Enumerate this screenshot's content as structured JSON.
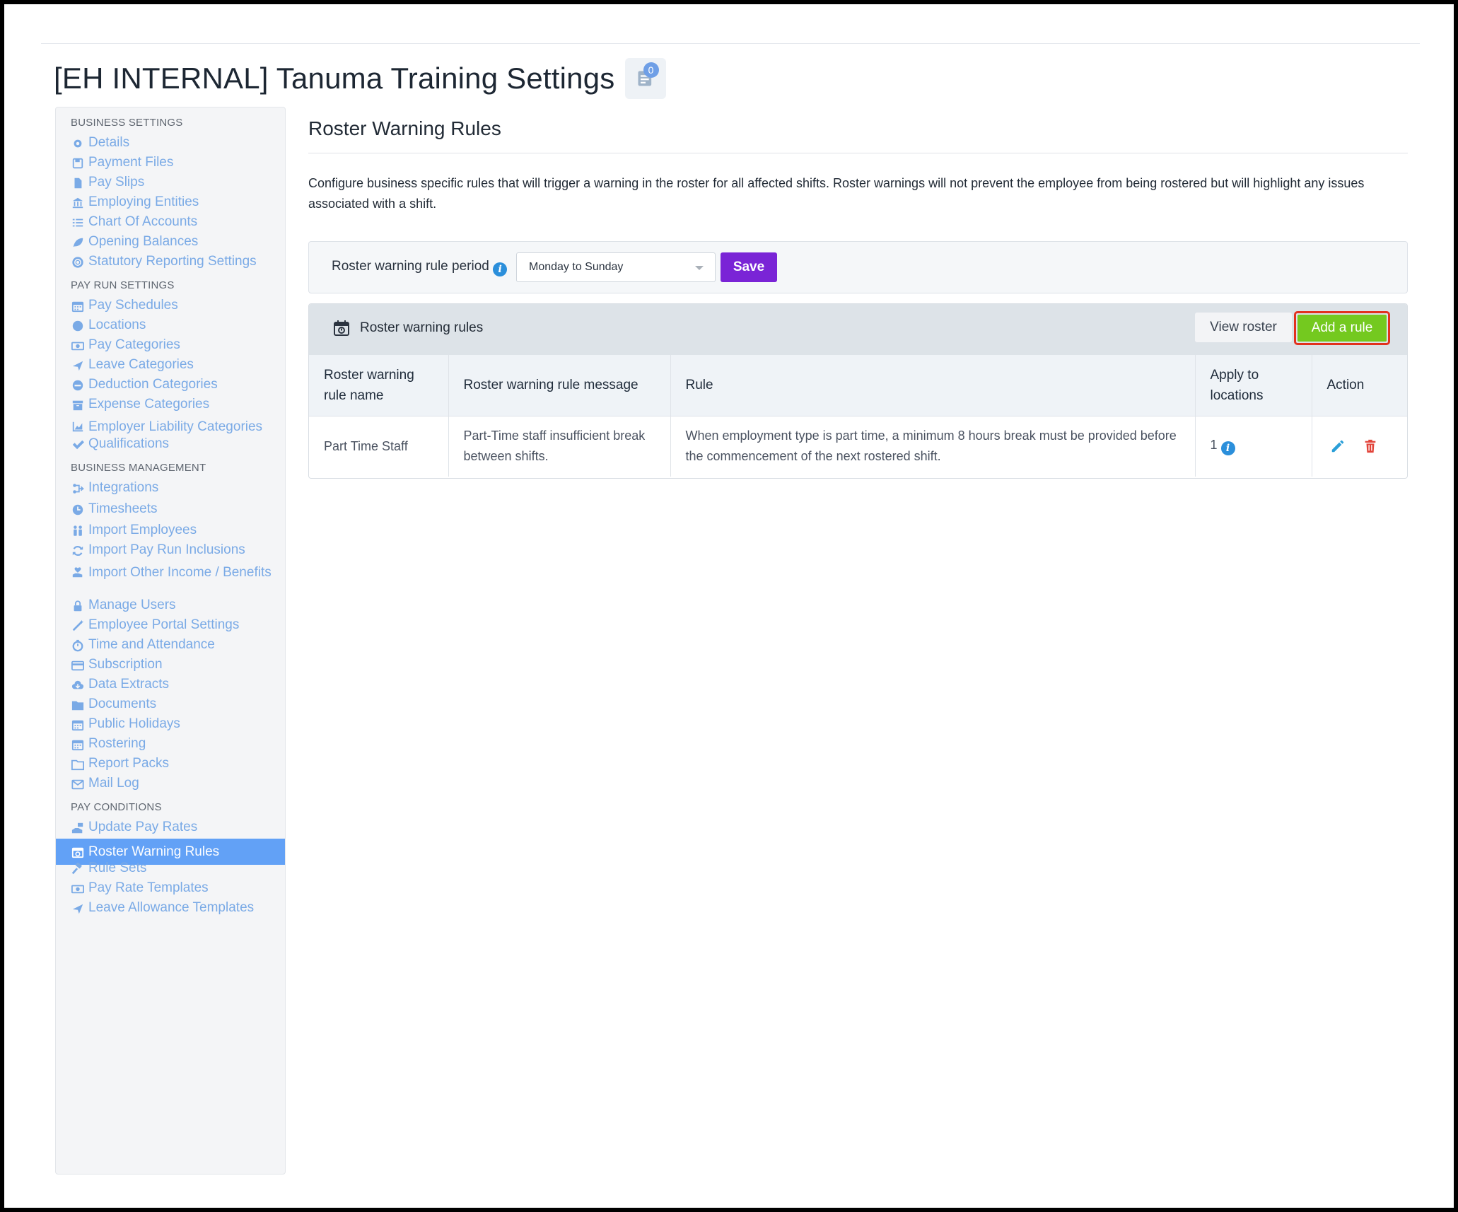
{
  "page": {
    "title": "[EH INTERNAL] Tanuma Training Settings",
    "notification_count": "0"
  },
  "sidebar": {
    "sections": [
      {
        "heading": "BUSINESS SETTINGS",
        "items": [
          {
            "label": "Details",
            "icon": "gear-icon"
          },
          {
            "label": "Payment Files",
            "icon": "floppy-icon"
          },
          {
            "label": "Pay Slips",
            "icon": "file-icon"
          },
          {
            "label": "Employing Entities",
            "icon": "bank-icon"
          },
          {
            "label": "Chart Of Accounts",
            "icon": "list-icon"
          },
          {
            "label": "Opening Balances",
            "icon": "leaf-icon"
          },
          {
            "label": "Statutory Reporting Settings",
            "icon": "lifebuoy-icon"
          }
        ]
      },
      {
        "heading": "PAY RUN SETTINGS",
        "items": [
          {
            "label": "Pay Schedules",
            "icon": "calendar-icon"
          },
          {
            "label": "Locations",
            "icon": "globe-icon"
          },
          {
            "label": "Pay Categories",
            "icon": "money-icon"
          },
          {
            "label": "Leave Categories",
            "icon": "plane-icon"
          },
          {
            "label": "Deduction Categories",
            "icon": "minus-circle-icon"
          },
          {
            "label": "Expense Categories",
            "icon": "archive-icon"
          },
          {
            "label": "Employer Liability Categories",
            "icon": "chart-icon"
          },
          {
            "label": "Qualifications",
            "icon": "check-icon"
          }
        ]
      },
      {
        "heading": "BUSINESS MANAGEMENT",
        "items": [
          {
            "label": "Integrations",
            "icon": "integrations-icon"
          },
          {
            "label": "Timesheets",
            "icon": "clock-icon"
          },
          {
            "label": "Import Employees",
            "icon": "people-icon"
          },
          {
            "label": "Import Pay Run Inclusions",
            "icon": "refresh-icon"
          },
          {
            "label": "Import Other Income / Benefits",
            "icon": "hand-heart-icon"
          },
          {
            "label": "Manage Users",
            "icon": "lock-icon"
          },
          {
            "label": "Employee Portal Settings",
            "icon": "wand-icon"
          },
          {
            "label": "Time and Attendance",
            "icon": "stopwatch-icon"
          },
          {
            "label": "Subscription",
            "icon": "credit-card-icon"
          },
          {
            "label": "Data Extracts",
            "icon": "cloud-download-icon"
          },
          {
            "label": "Documents",
            "icon": "folder-icon"
          },
          {
            "label": "Public Holidays",
            "icon": "calendar-icon"
          },
          {
            "label": "Rostering",
            "icon": "calendar-icon"
          },
          {
            "label": "Report Packs",
            "icon": "folder-open-icon"
          },
          {
            "label": "Mail Log",
            "icon": "envelope-icon"
          }
        ]
      },
      {
        "heading": "PAY CONDITIONS",
        "items": [
          {
            "label": "Update Pay Rates",
            "icon": "hand-money-icon"
          },
          {
            "label": "Roster Warning Rules",
            "icon": "calendar-alert-icon",
            "active": true
          },
          {
            "label": "Rule Sets",
            "icon": "gavel-icon"
          },
          {
            "label": "Pay Rate Templates",
            "icon": "money-icon"
          },
          {
            "label": "Leave Allowance Templates",
            "icon": "plane-icon"
          }
        ]
      }
    ]
  },
  "main": {
    "section_title": "Roster Warning Rules",
    "description": "Configure business specific rules that will trigger a warning in the roster for all affected shifts. Roster warnings will not prevent the employee from being rostered but will highlight any issues associated with a shift.",
    "period": {
      "label": "Roster warning rule period",
      "selected": "Monday to Sunday",
      "save_label": "Save"
    },
    "panel": {
      "title": "Roster warning rules",
      "view_roster_label": "View roster",
      "add_rule_label": "Add a rule",
      "columns": [
        "Roster warning rule name",
        "Roster warning rule message",
        "Rule",
        "Apply to locations",
        "Action"
      ],
      "rows": [
        {
          "name": "Part Time Staff",
          "message": "Part-Time staff insufficient break between shifts.",
          "rule": "When employment type is part time, a minimum 8 hours break must be provided before the commencement of the next rostered shift.",
          "locations": "1"
        }
      ]
    }
  },
  "colors": {
    "sidebar_link": "#7aaae6",
    "sidebar_active_bg": "#62a1f6",
    "save_button": "#7a24d6",
    "add_rule_button": "#74c91f",
    "add_rule_highlight": "#e2321e",
    "edit_icon": "#2a9fd8",
    "delete_icon": "#e2443a"
  }
}
